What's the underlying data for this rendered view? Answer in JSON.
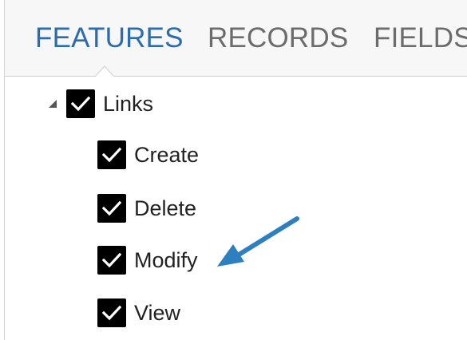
{
  "tabs": [
    {
      "label": "FEATURES",
      "active": true
    },
    {
      "label": "RECORDS",
      "active": false
    },
    {
      "label": "FIELDS",
      "active": false
    }
  ],
  "tree": {
    "parent": {
      "label": "Links",
      "checked": true,
      "expanded": true
    },
    "children": [
      {
        "label": "Create",
        "checked": true
      },
      {
        "label": "Delete",
        "checked": true
      },
      {
        "label": "Modify",
        "checked": true
      },
      {
        "label": "View",
        "checked": true
      }
    ]
  },
  "annotation": {
    "icon": "pointer-arrow-icon",
    "target": "Modify",
    "color": "#2e7fbf"
  },
  "colors": {
    "active_tab": "#2b6cae",
    "inactive_tab": "#6c6c6c",
    "checkbox": "#000000"
  }
}
